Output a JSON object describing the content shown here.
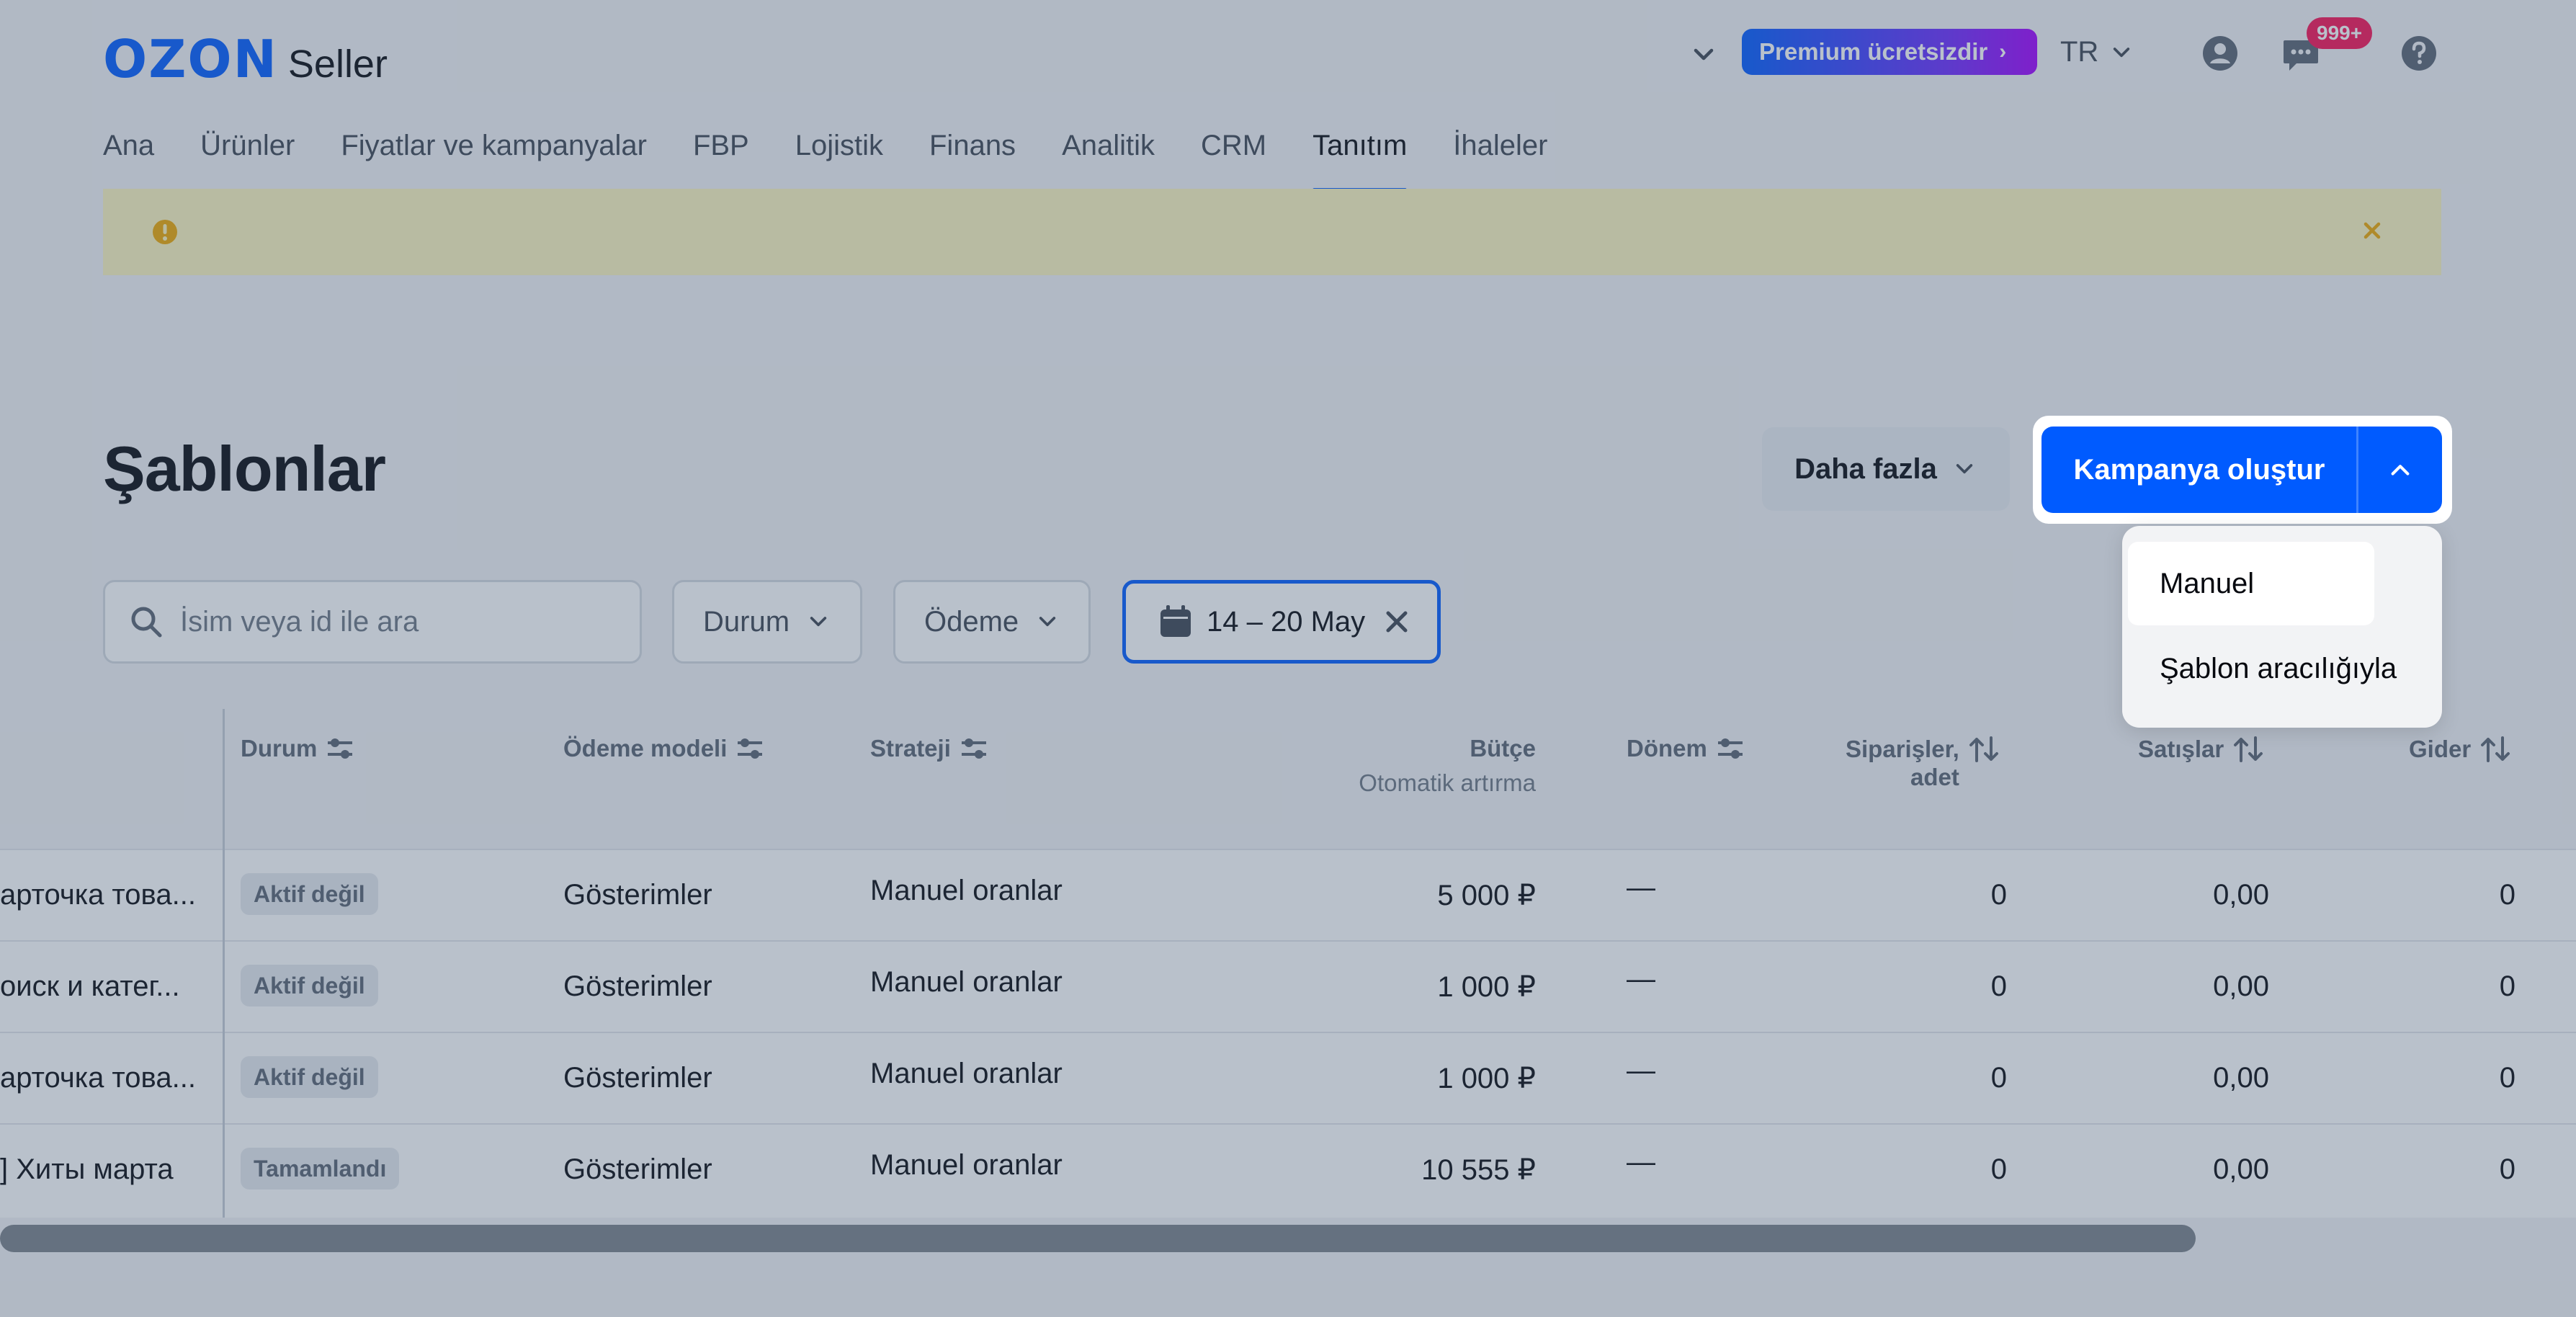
{
  "brand": {
    "logo_main": "OZON",
    "logo_sub": "Seller"
  },
  "topbar": {
    "premium_label": "Premium ücretsizdir",
    "premium_arrow": "›",
    "language": "TR",
    "notification_count": "999+"
  },
  "nav": {
    "items": [
      {
        "label": "Ana",
        "active": false
      },
      {
        "label": "Ürünler",
        "active": false
      },
      {
        "label": "Fiyatlar ve kampanyalar",
        "active": false
      },
      {
        "label": "FBP",
        "active": false
      },
      {
        "label": "Lojistik",
        "active": false
      },
      {
        "label": "Finans",
        "active": false
      },
      {
        "label": "Analitik",
        "active": false
      },
      {
        "label": "CRM",
        "active": false
      },
      {
        "label": "Tanıtım",
        "active": true
      },
      {
        "label": "İhaleler",
        "active": false
      }
    ]
  },
  "page": {
    "title": "Şablonlar"
  },
  "actions": {
    "more_label": "Daha fazla",
    "create_label": "Kampanya oluştur"
  },
  "create_menu": {
    "items": [
      {
        "label": "Manuel",
        "selected": true
      },
      {
        "label": "Şablon aracılığıyla",
        "selected": false
      }
    ]
  },
  "filters": {
    "search_placeholder": "İsim veya id ile ara",
    "status_label": "Durum",
    "payment_label": "Ödeme",
    "date_range": "14 – 20 May"
  },
  "table": {
    "headers": {
      "status": "Durum",
      "payment_model": "Ödeme modeli",
      "strategy": "Strateji",
      "budget": "Bütçe",
      "budget_sub": "Otomatik artırma",
      "period": "Dönem",
      "orders": "Siparişler,",
      "orders_sub": "adet",
      "sales": "Satışlar",
      "expense": "Gider"
    },
    "rows": [
      {
        "name": "арточка това...",
        "status": "Aktif değil",
        "payment": "Gösterimler",
        "strategy": "Manuel oranlar",
        "budget": "5 000 ₽",
        "period": "—",
        "orders": "0",
        "sales": "0,00",
        "expense": "0"
      },
      {
        "name": "оиск и катег...",
        "status": "Aktif değil",
        "payment": "Gösterimler",
        "strategy": "Manuel oranlar",
        "budget": "1 000 ₽",
        "period": "—",
        "orders": "0",
        "sales": "0,00",
        "expense": "0"
      },
      {
        "name": "арточка това...",
        "status": "Aktif değil",
        "payment": "Gösterimler",
        "strategy": "Manuel oranlar",
        "budget": "1 000 ₽",
        "period": "—",
        "orders": "0",
        "sales": "0,00",
        "expense": "0"
      },
      {
        "name": "] Хиты марта",
        "status": "Tamamlandı",
        "payment": "Gösterimler",
        "strategy": "Manuel oranlar",
        "budget": "10 555 ₽",
        "period": "—",
        "orders": "0",
        "sales": "0,00",
        "expense": "0"
      }
    ]
  },
  "icons": {
    "dropdown": "chevron-down-icon",
    "profile": "user-icon",
    "messages": "chat-icon",
    "help": "help-icon",
    "alert": "warning-icon",
    "close": "close-icon",
    "search": "search-icon",
    "calendar": "calendar-icon",
    "filter": "filter-settings-icon",
    "sort": "sort-icon"
  },
  "colors": {
    "brand": "#005bff",
    "premium_gradient_end": "#a300ff",
    "badge": "#f91155",
    "alert_bg": "#fdf5bf",
    "alert_icon": "#f0a800",
    "overlay": "rgba(66,86,113,0.37)"
  }
}
